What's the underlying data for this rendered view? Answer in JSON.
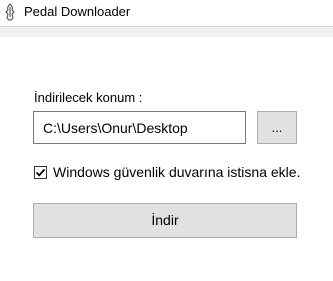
{
  "window": {
    "title": "Pedal Downloader",
    "icon": "pedal-app-icon"
  },
  "form": {
    "location_label": "İndirilecek konum :",
    "path_value": "C:\\Users\\Onur\\Desktop",
    "browse_label": "...",
    "firewall_checkbox_label": "Windows güvenlik duvarına istisna ekle.",
    "firewall_checked": true,
    "download_label": "İndir"
  },
  "colors": {
    "button_bg": "#e1e1e1",
    "button_border": "#adadad",
    "input_border": "#7a7a7a"
  }
}
